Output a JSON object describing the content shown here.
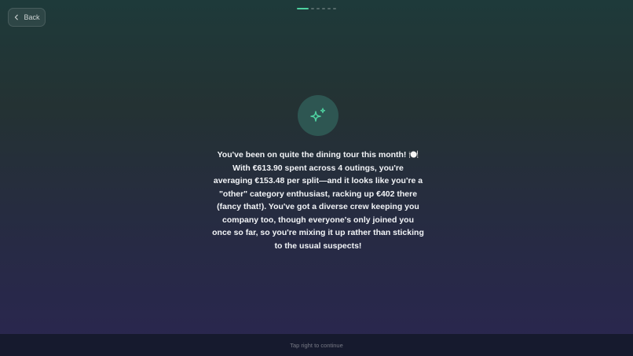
{
  "nav": {
    "back_label": "Back"
  },
  "progress": {
    "total_steps": 6,
    "current_step": 1,
    "accent_color": "#4ed1a0"
  },
  "hero": {
    "icon": "sparkles-icon"
  },
  "summary": {
    "text": "You've been on quite the dining tour this month! 🍽️ With €613.90 spent across 4 outings, you're averaging €153.48 per split—and it looks like you're a \"other\" category enthusiast, racking up €402 there (fancy that!). You've got a diverse crew keeping you company too, though everyone's only joined you once so far, so you're mixing it up rather than sticking to the usual suspects!"
  },
  "footer": {
    "hint": "Tap right to continue"
  }
}
